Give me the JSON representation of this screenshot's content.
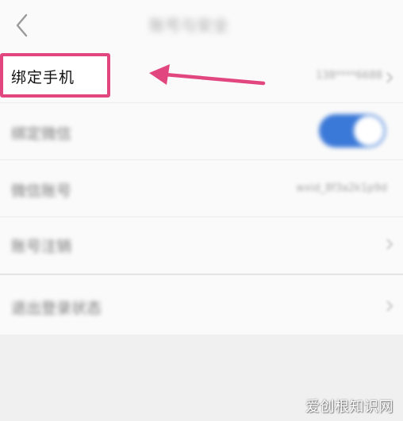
{
  "header": {
    "back_icon": "chevron-left-icon",
    "title": "账号与安全"
  },
  "rows": [
    {
      "label": "绑定手机",
      "value": "138****6688",
      "chevron": "chevron-right-icon",
      "highlighted": true
    },
    {
      "label": "绑定微信",
      "toggle_on": true
    },
    {
      "label": "微信账号",
      "value": "wxid_8f3a2k1p9d"
    },
    {
      "label": "账号注销",
      "chevron": "chevron-right-icon"
    },
    {
      "label": "退出登录状态",
      "chevron": "chevron-right-icon"
    }
  ],
  "annotation": {
    "box_color": "#e2467f",
    "arrow_color": "#e2467f"
  },
  "toggle_color": "#3b79d8",
  "watermark": "爱创根知识网"
}
